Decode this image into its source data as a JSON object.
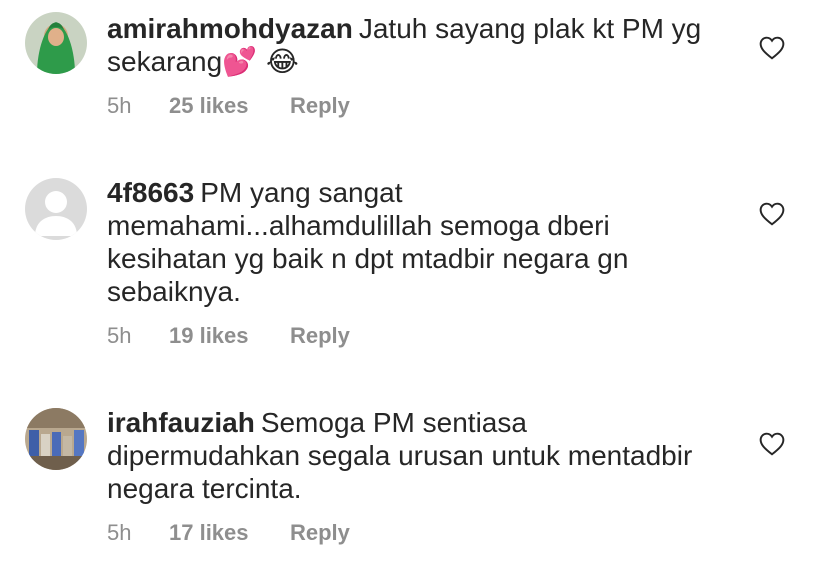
{
  "comments": [
    {
      "username": "amirahmohdyazan",
      "text": "Jatuh sayang plak kt PM yg sekarang",
      "emoji": "💕 😂",
      "time": "5h",
      "likes": "25 likes",
      "reply": "Reply",
      "avatar": "avatar-woman-green-hijab"
    },
    {
      "username": "4f8663",
      "text": "PM yang sangat memahami...alhamdulillah semoga dberi kesihatan yg baik n  dpt mtadbir negara gn sebaiknya.",
      "emoji": "",
      "time": "5h",
      "likes": "19 likes",
      "reply": "Reply",
      "avatar": "avatar-default-silhouette"
    },
    {
      "username": "irahfauziah",
      "text": "Semoga PM sentiasa dipermudahkan segala urusan untuk mentadbir negara tercinta.",
      "emoji": "",
      "time": "5h",
      "likes": "17 likes",
      "reply": "Reply",
      "avatar": "avatar-photo-crowd"
    }
  ],
  "colors": {
    "text": "#262626",
    "meta": "#8e8e8e",
    "heart_outline": "#262626",
    "default_avatar_bg": "#dbdbdb"
  },
  "icons": {
    "like": "heart-outline-icon"
  }
}
